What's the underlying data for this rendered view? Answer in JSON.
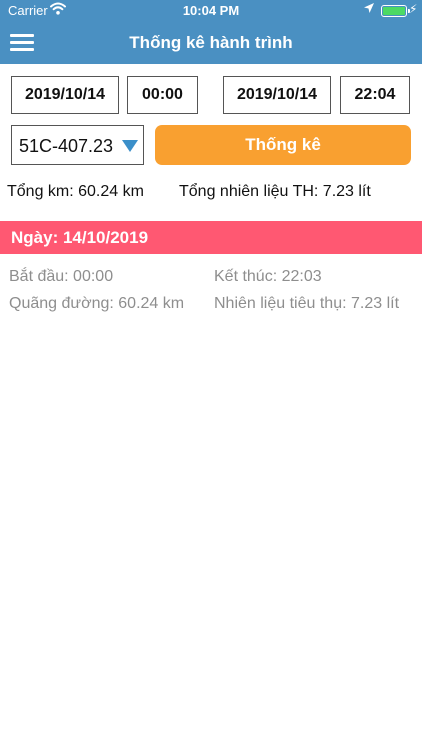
{
  "status_bar": {
    "carrier": "Carrier",
    "time": "10:04 PM"
  },
  "header": {
    "title": "Thống kê hành trình"
  },
  "filter": {
    "start_date": "2019/10/14",
    "start_time": "00:00",
    "end_date": "2019/10/14",
    "end_time": "22:04",
    "vehicle": "51C-407.23",
    "submit_label": "Thống kê"
  },
  "summary": {
    "total_km": "Tổng km: 60.24 km",
    "total_fuel": "Tổng nhiên liệu TH: 7.23 lít"
  },
  "trip": {
    "day_label": "Ngày: 14/10/2019",
    "start": "Bắt đầu: 00:00",
    "end": "Kết thúc: 22:03",
    "distance": "Quãng đường: 60.24 km",
    "fuel": "Nhiên liệu tiêu thụ: 7.23 lít"
  },
  "colors": {
    "header_bg": "#4a90c2",
    "button_bg": "#f9a030",
    "day_bar_bg": "#ff5872",
    "dropdown_arrow": "#3b8fc9"
  }
}
